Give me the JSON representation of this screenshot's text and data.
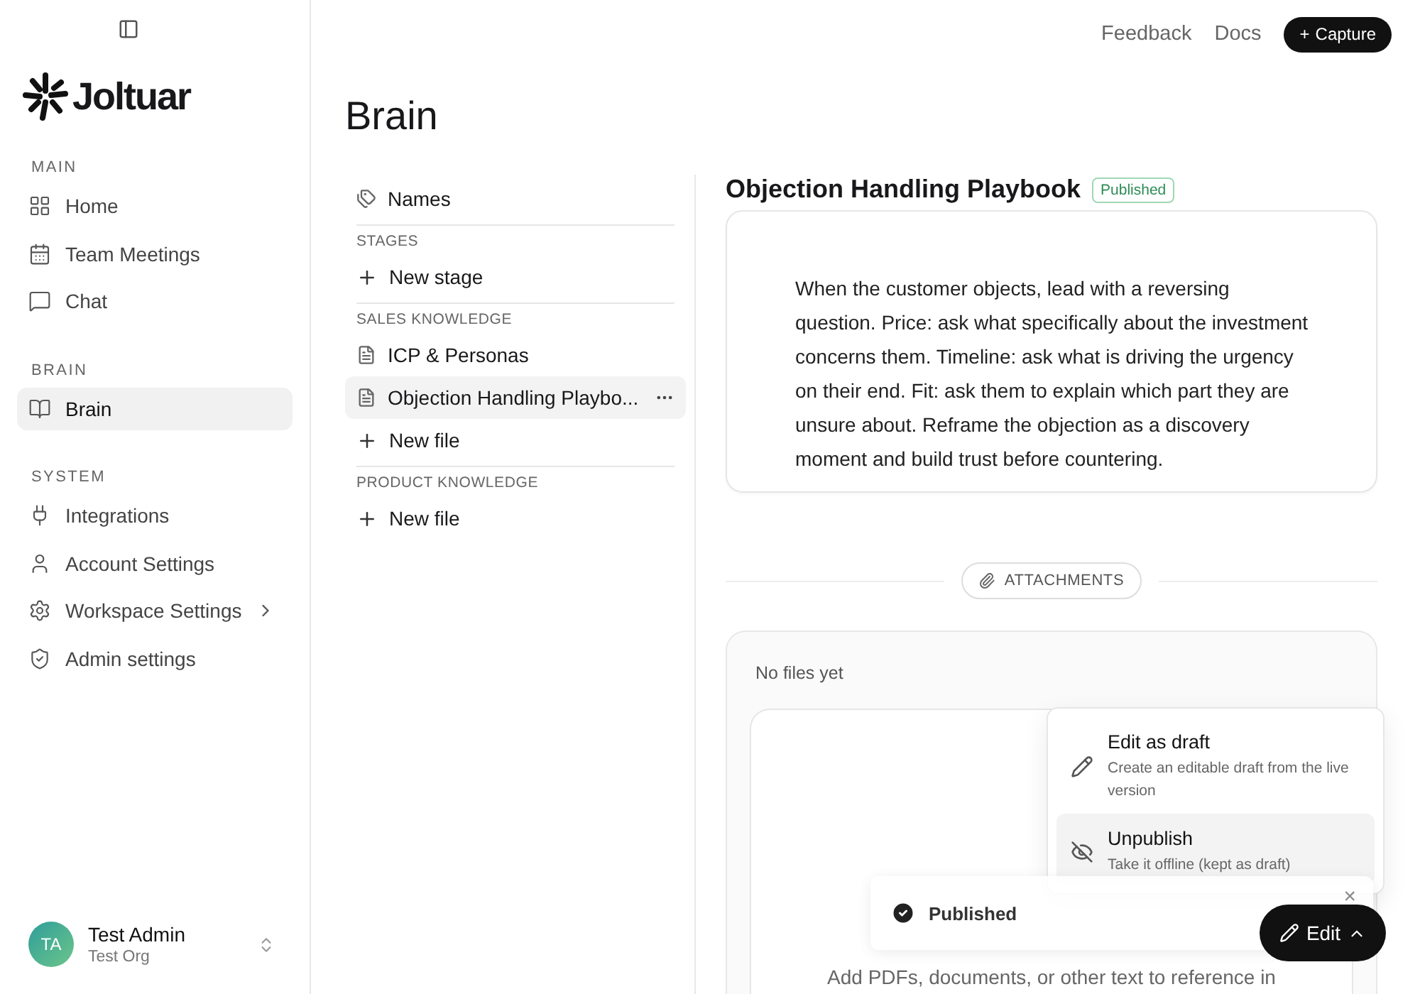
{
  "sidebar": {
    "logo": "Joltuar",
    "sections": [
      {
        "heading": "MAIN",
        "items": [
          {
            "label": "Home",
            "selected": false,
            "has_submenu": false
          },
          {
            "label": "Team Meetings",
            "selected": false,
            "has_submenu": false
          },
          {
            "label": "Chat",
            "selected": false,
            "has_submenu": false
          }
        ]
      },
      {
        "heading": "BRAIN",
        "items": [
          {
            "label": "Brain",
            "selected": true,
            "has_submenu": false
          }
        ]
      },
      {
        "heading": "SYSTEM",
        "items": [
          {
            "label": "Integrations",
            "selected": false,
            "has_submenu": false
          },
          {
            "label": "Account Settings",
            "selected": false,
            "has_submenu": false
          },
          {
            "label": "Workspace Settings",
            "selected": false,
            "has_submenu": true
          },
          {
            "label": "Admin settings",
            "selected": false,
            "has_submenu": false
          }
        ]
      }
    ],
    "user": {
      "initials": "TA",
      "name": "Test Admin",
      "org": "Test Org"
    }
  },
  "header": {
    "links": [
      "Feedback",
      "Docs"
    ],
    "capture_button": {
      "icon": "+",
      "label": "Capture"
    }
  },
  "page_title": "Brain",
  "nav": {
    "top_item": "Names",
    "sections": [
      {
        "heading": "STAGES",
        "items": [
          {
            "kind": "add",
            "label": "New stage",
            "selected": false
          }
        ]
      },
      {
        "heading": "SALES KNOWLEDGE",
        "items": [
          {
            "kind": "file",
            "label": "ICP & Personas",
            "selected": false
          },
          {
            "kind": "file",
            "label": "Objection Handling Playbo...",
            "selected": true
          },
          {
            "kind": "add",
            "label": "New file",
            "selected": false
          }
        ]
      },
      {
        "heading": "PRODUCT KNOWLEDGE",
        "items": [
          {
            "kind": "add",
            "label": "New file",
            "selected": false
          }
        ]
      }
    ]
  },
  "document": {
    "title": "Objection Handling Playbook",
    "status": "Published",
    "body": "When the customer objects, lead with a reversing question. Price: ask what specifically about the investment concerns them. Timeline: ask what is driving the urgency on their end. Fit: ask them to explain which part they are unsure about. Reframe the objection as a discovery moment and build trust before countering."
  },
  "attachments": {
    "label": "ATTACHMENTS",
    "empty_text": "No files yet",
    "drop_text": "Add PDFs, documents, or other text to reference in"
  },
  "edit_menu": {
    "items": [
      {
        "title": "Edit as draft",
        "description": "Create an editable draft from the live version",
        "selected": false
      },
      {
        "title": "Unpublish",
        "description": "Take it offline (kept as draft)",
        "selected": true
      }
    ]
  },
  "toast": {
    "message": "Published",
    "close": "×"
  },
  "edit_button": {
    "label": "Edit"
  }
}
